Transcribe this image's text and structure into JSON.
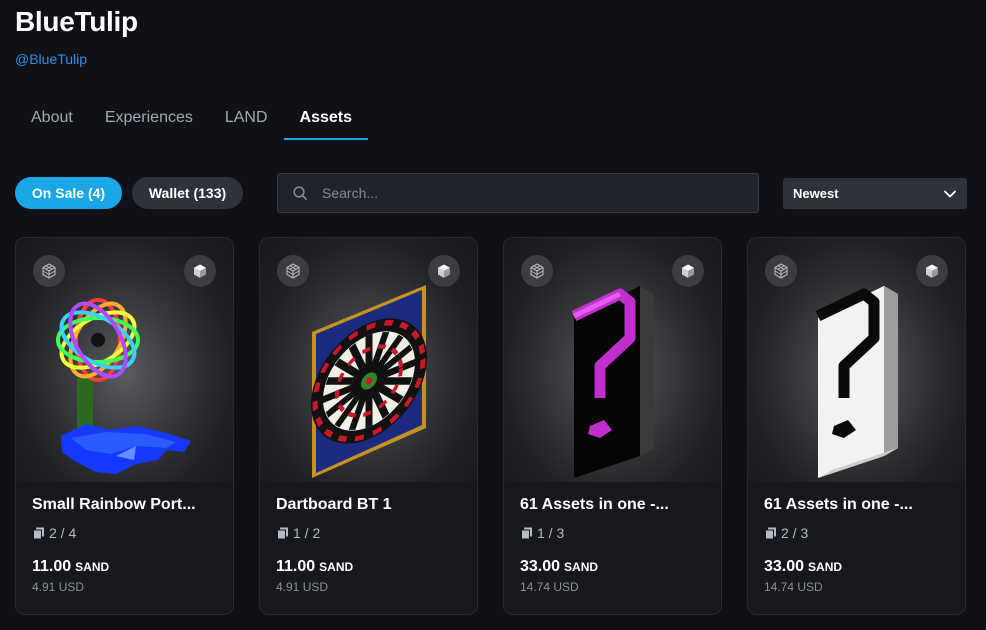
{
  "profile": {
    "name": "BlueTulip",
    "handle": "@BlueTulip"
  },
  "tabs": [
    {
      "label": "About",
      "active": false
    },
    {
      "label": "Experiences",
      "active": false
    },
    {
      "label": "LAND",
      "active": false
    },
    {
      "label": "Assets",
      "active": true
    }
  ],
  "filters": {
    "on_sale": "On Sale (4)",
    "wallet": "Wallet (133)"
  },
  "search": {
    "placeholder": "Search...",
    "value": ""
  },
  "sort": {
    "selected": "Newest"
  },
  "colors": {
    "accent": "#1aa7e8",
    "background": "#0f1116",
    "handle": "#2b8ee6"
  },
  "cards": [
    {
      "title": "Small Rainbow Port...",
      "editions": "2 / 4",
      "price": "11.00",
      "currency": "SAND",
      "usd": "4.91 USD",
      "art": "rainbow-portal"
    },
    {
      "title": "Dartboard BT 1",
      "editions": "1 / 2",
      "price": "11.00",
      "currency": "SAND",
      "usd": "4.91 USD",
      "art": "dartboard"
    },
    {
      "title": "61 Assets in one -...",
      "editions": "1 / 3",
      "price": "33.00",
      "currency": "SAND",
      "usd": "14.74 USD",
      "art": "question-mark-black"
    },
    {
      "title": "61 Assets in one -...",
      "editions": "2 / 3",
      "price": "33.00",
      "currency": "SAND",
      "usd": "14.74 USD",
      "art": "question-mark-white"
    }
  ],
  "icons": {
    "search": "search-icon",
    "dropdown": "chevron-down-icon",
    "model_3d": "3d-model-icon",
    "cube": "cube-icon",
    "editions": "editions-icon"
  }
}
